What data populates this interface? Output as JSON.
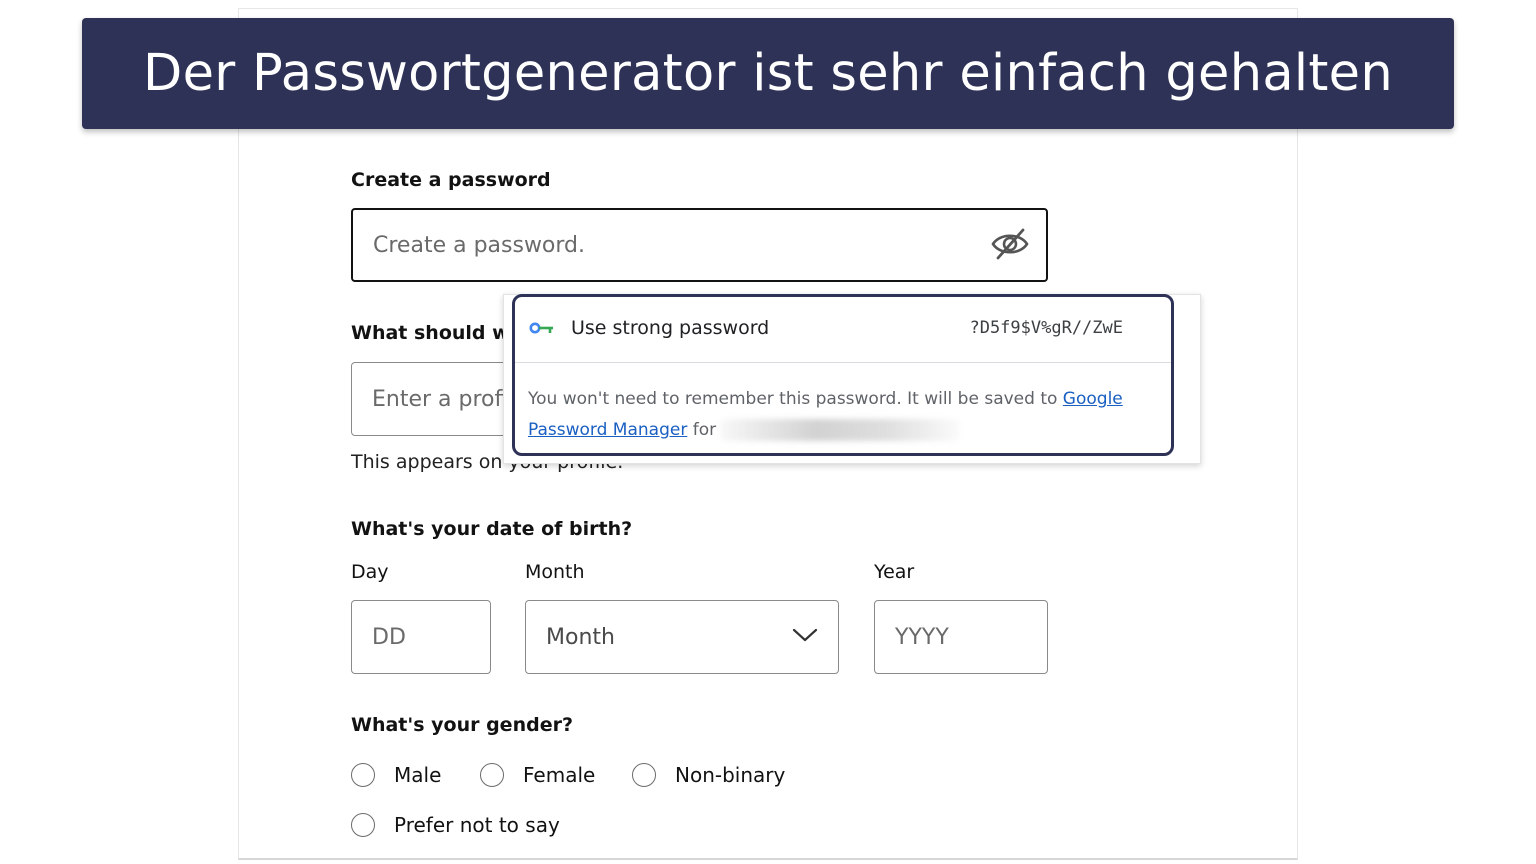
{
  "banner": {
    "text": "Der Passwortgenerator ist sehr einfach gehalten"
  },
  "password": {
    "label": "Create a password",
    "placeholder": "Create a password."
  },
  "profile_name": {
    "label": "What should we call you?",
    "placeholder": "Enter a profile name.",
    "helper": "This appears on your profile."
  },
  "password_popup": {
    "suggest_label": "Use strong password",
    "suggested_password": "?D5f9$V%gR//ZwE",
    "info_text": "You won't need to remember this password. It will be saved to",
    "link_text": "Google Password Manager",
    "for_text": "for"
  },
  "dob": {
    "label": "What's your date of birth?",
    "day_label": "Day",
    "day_placeholder": "DD",
    "month_label": "Month",
    "month_value": "Month",
    "year_label": "Year",
    "year_placeholder": "YYYY"
  },
  "gender": {
    "label": "What's your gender?",
    "options": [
      "Male",
      "Female",
      "Non-binary",
      "Prefer not to say"
    ]
  },
  "colors": {
    "banner_bg": "#2e3257",
    "link": "#1a5fc2",
    "key_icon_blue": "#4285f4",
    "key_icon_green": "#34a853"
  }
}
